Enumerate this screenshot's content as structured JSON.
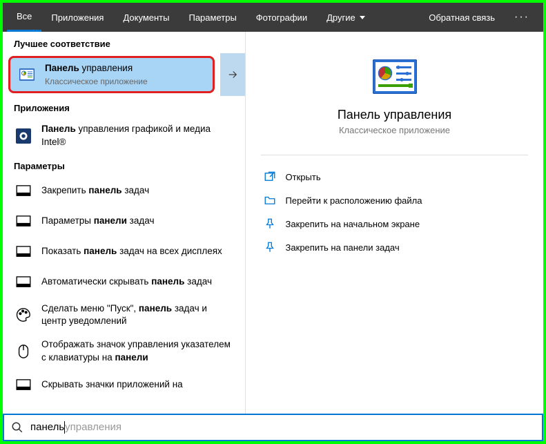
{
  "tabs": {
    "all": "Все",
    "apps": "Приложения",
    "docs": "Документы",
    "settings": "Параметры",
    "photos": "Фотографии",
    "other": "Другие",
    "feedback": "Обратная связь"
  },
  "sections": {
    "best_match": "Лучшее соответствие",
    "applications": "Приложения",
    "parameters": "Параметры"
  },
  "best_match": {
    "title_bold": "Панель",
    "title_rest": " управления",
    "subtitle": "Классическое приложение"
  },
  "app_results": [
    {
      "pre": "",
      "bold": "Панель",
      "post": " управления графикой и медиа Intel®"
    }
  ],
  "param_results": [
    {
      "pre": "Закрепить ",
      "bold": "панель",
      "post": " задач"
    },
    {
      "pre": "Параметры ",
      "bold": "панели",
      "post": " задач"
    },
    {
      "pre": "Показать ",
      "bold": "панель",
      "post": " задач на всех дисплеях"
    },
    {
      "pre": "Автоматически скрывать ",
      "bold": "панель",
      "post": " задач"
    },
    {
      "pre": "Сделать меню \"Пуск\", ",
      "bold": "панель",
      "post": " задач и центр уведомлений"
    },
    {
      "pre": "Отображать значок управления указателем с клавиатуры на ",
      "bold": "панели",
      "post": ""
    },
    {
      "pre": "Скрывать значки приложений на",
      "bold": "",
      "post": ""
    }
  ],
  "detail": {
    "title": "Панель управления",
    "subtitle": "Классическое приложение",
    "actions": {
      "open": "Открыть",
      "location": "Перейти к расположению файла",
      "pin_start": "Закрепить на начальном экране",
      "pin_taskbar": "Закрепить на панели задач"
    }
  },
  "search": {
    "typed": "панель",
    "suggest": "управления"
  }
}
